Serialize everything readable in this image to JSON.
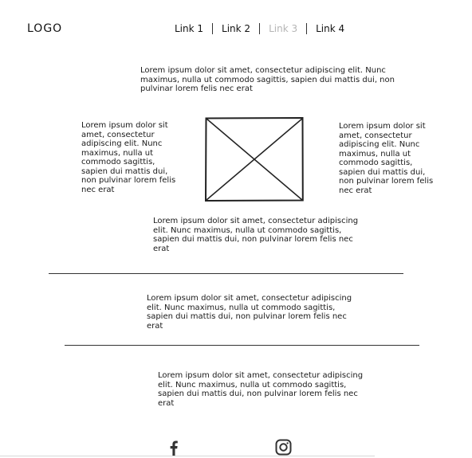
{
  "header": {
    "logo": "LOGO",
    "nav": [
      {
        "label": "Link 1",
        "state": "normal"
      },
      {
        "label": "Link 2",
        "state": "normal"
      },
      {
        "label": "Link 3",
        "state": "muted"
      },
      {
        "label": "Link 4",
        "state": "normal"
      }
    ]
  },
  "content": {
    "intro": "Lorem ipsum dolor sit amet, consectetur adipiscing elit. Nunc maximus, nulla ut commodo sagittis, sapien dui mattis dui, non pulvinar lorem felis nec erat",
    "left_text": "Lorem ipsum dolor sit amet, consectetur adipiscing elit. Nunc maximus, nulla ut commodo sagittis, sapien dui mattis dui, non pulvinar lorem felis nec erat",
    "right_text": "Lorem ipsum dolor sit amet, consectetur adipiscing elit. Nunc maximus, nulla ut commodo sagittis, sapien dui mattis dui, non pulvinar lorem felis nec erat",
    "below_image": "Lorem ipsum dolor sit amet, consectetur adipiscing elit. Nunc maximus, nulla ut commodo sagittis, sapien dui mattis dui, non pulvinar lorem felis nec erat",
    "section_1": "Lorem ipsum dolor sit amet, consectetur adipiscing elit. Nunc maximus, nulla ut commodo sagittis, sapien dui mattis dui, non pulvinar lorem felis nec erat",
    "section_2": "Lorem ipsum dolor sit amet, consectetur adipiscing elit. Nunc maximus, nulla ut commodo sagittis, sapien dui mattis dui, non pulvinar lorem felis nec erat"
  },
  "footer": {
    "social_icons": [
      "facebook-icon",
      "instagram-icon"
    ]
  },
  "colors": {
    "text": "#1a1a1a",
    "muted_link": "#b5b5b5",
    "rule": "#333333",
    "background": "#ffffff"
  }
}
